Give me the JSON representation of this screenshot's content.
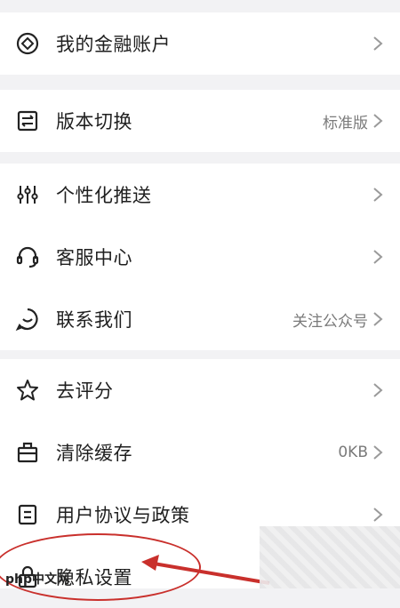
{
  "groups": [
    {
      "items": [
        {
          "label": "我的金融账户",
          "value": "",
          "icon": "finance-icon"
        }
      ]
    },
    {
      "items": [
        {
          "label": "版本切换",
          "value": "标准版",
          "icon": "switch-icon"
        }
      ]
    },
    {
      "items": [
        {
          "label": "个性化推送",
          "value": "",
          "icon": "sliders-icon"
        },
        {
          "label": "客服中心",
          "value": "",
          "icon": "headset-icon"
        },
        {
          "label": "联系我们",
          "value": "关注公众号",
          "icon": "chat-icon"
        }
      ]
    },
    {
      "items": [
        {
          "label": "去评分",
          "value": "",
          "icon": "star-icon"
        },
        {
          "label": "清除缓存",
          "value": "0KB",
          "icon": "cache-icon"
        },
        {
          "label": "用户协议与政策",
          "value": "",
          "icon": "document-icon"
        },
        {
          "label": "隐私设置",
          "value": "",
          "icon": "lock-icon"
        }
      ]
    }
  ],
  "watermark": {
    "logo_text": "php中文网"
  },
  "colors": {
    "annotation": "#c9302c",
    "background": "#f2f2f4"
  }
}
